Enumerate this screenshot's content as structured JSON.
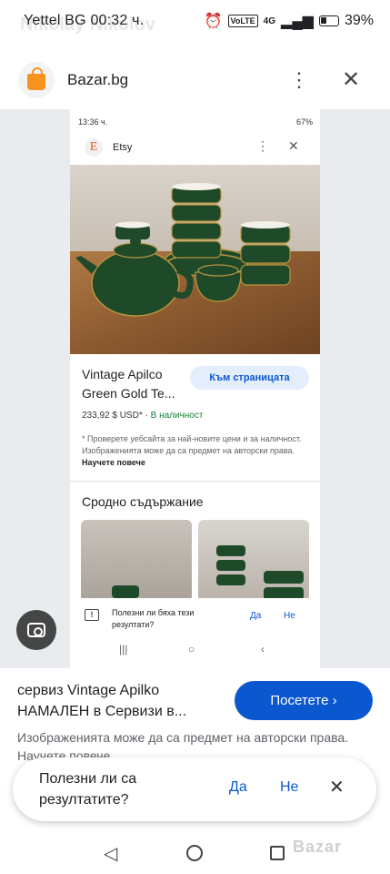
{
  "status_bar": {
    "carrier_time": "Yettel BG 00:32 ч.",
    "ghost_name": "Nikolay Nikolov",
    "network": "4G",
    "volte": "VoLTE",
    "battery": "39%"
  },
  "header": {
    "site_title": "Bazar.bg",
    "menu_icon": "kebab-menu-icon",
    "close_icon": "close-icon"
  },
  "inner": {
    "status_time": "13:36 ч.",
    "status_battery": "67%",
    "site_name": "Etsy",
    "etsy_letter": "E",
    "product_title": "Vintage Apilco Green Gold Te...",
    "visit_label": "Към страницата",
    "price": "233,92 $ USD*",
    "dot": "·",
    "stock": "В наличност",
    "disclaimer": "* Проверете уебсайта за най-новите цени и за наличност. Изображенията може да са предмет на авторски права.",
    "learn_more": "Научете повече",
    "related_title": "Сродно съдържание",
    "feedback_question": "Полезни ли бяха тези резултати?",
    "feedback_yes": "Да",
    "feedback_no": "Не",
    "nav_recent": "|||",
    "nav_home": "○",
    "nav_back": "‹"
  },
  "result": {
    "title": "сервиз Vintage Apilko НАМАЛЕН в Сервизи в...",
    "visit_label": "Посетете ›",
    "disclaimer": "Изображенията може да са предмет на авторски права. Научете повече"
  },
  "feedback": {
    "question": "Полезни ли са резултатите?",
    "yes": "Да",
    "no": "Не",
    "close": "✕"
  },
  "watermark": "Bazar",
  "colors": {
    "accent": "#0b57d0",
    "bazar_orange": "#f7931e",
    "teapot_green": "#1f4a2a",
    "stock_green": "#188038"
  }
}
